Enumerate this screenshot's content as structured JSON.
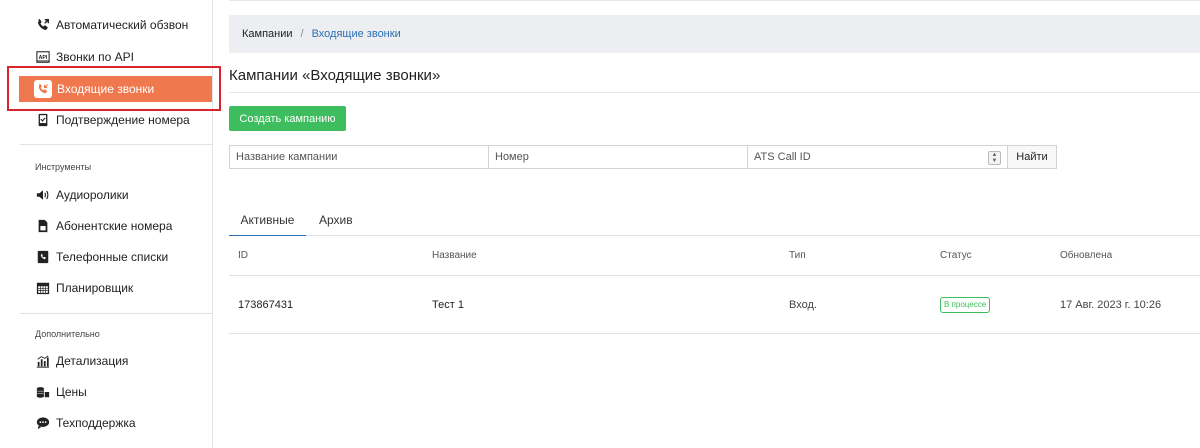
{
  "sidebar": {
    "items": [
      {
        "label": "Автоматический обзвон",
        "icon": "phone-outgoing-icon"
      },
      {
        "label": "Звонки по API",
        "icon": "api-icon"
      },
      {
        "label": "Входящие звонки",
        "icon": "phone-incoming-icon",
        "active": true
      },
      {
        "label": "Подтверждение номера",
        "icon": "phone-check-icon"
      }
    ],
    "tools_label": "Инструменты",
    "tools": [
      {
        "label": "Аудиоролики",
        "icon": "speaker-icon"
      },
      {
        "label": "Абонентские номера",
        "icon": "sim-card-icon"
      },
      {
        "label": "Телефонные списки",
        "icon": "phone-book-icon"
      },
      {
        "label": "Планировщик",
        "icon": "calendar-icon"
      }
    ],
    "extra_label": "Дополнительно",
    "extra": [
      {
        "label": "Детализация",
        "icon": "bar-chart-icon"
      },
      {
        "label": "Цены",
        "icon": "coins-icon"
      },
      {
        "label": "Техподдержка",
        "icon": "chat-icon"
      }
    ]
  },
  "breadcrumb": {
    "home": "Кампании",
    "separator": "/",
    "current": "Входящие звонки"
  },
  "page_title": "Кампании «Входящие звонки»",
  "create_button": "Создать кампанию",
  "filters": {
    "name_placeholder": "Название кампании",
    "number_placeholder": "Номер",
    "ats_placeholder": "ATS Call ID",
    "find_button": "Найти"
  },
  "tabs": [
    {
      "label": "Активные"
    },
    {
      "label": "Архив"
    }
  ],
  "table": {
    "headers": {
      "id": "ID",
      "name": "Название",
      "type": "Тип",
      "status": "Статус",
      "updated": "Обновлена"
    },
    "rows": [
      {
        "id": "173867431",
        "name": "Тест 1",
        "type": "Вход.",
        "status": "В процессе",
        "updated": "17 Авг. 2023 г. 10:26"
      }
    ]
  },
  "colors": {
    "accent_active": "#f0784e",
    "create_green": "#3ebd5e",
    "link_blue": "#2a6fb3",
    "highlight_red": "#d9232d"
  }
}
